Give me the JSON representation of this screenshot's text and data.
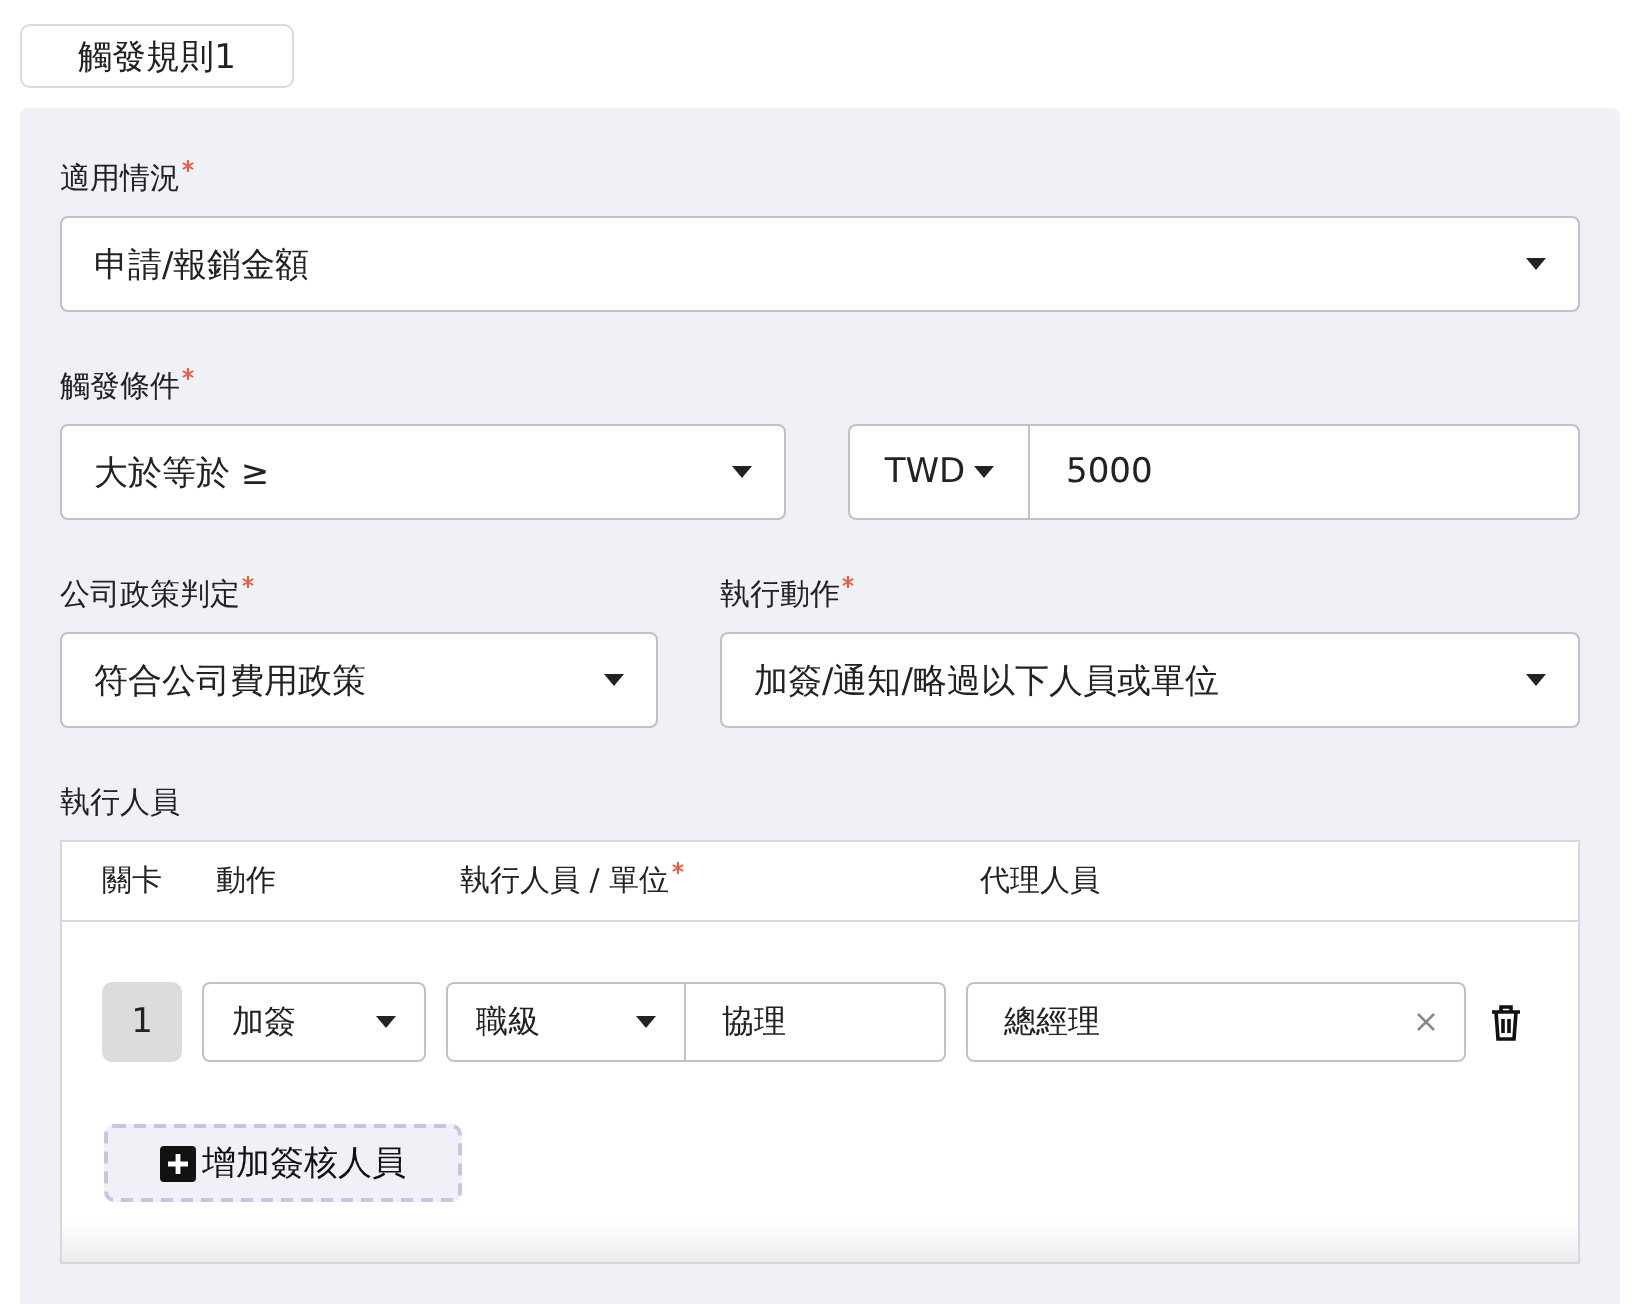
{
  "rule_tab": {
    "label": "觸發規則1"
  },
  "applicable": {
    "label": "適用情況",
    "required": true,
    "value": "申請/報銷金額"
  },
  "condition": {
    "label": "觸發條件",
    "required": true,
    "operator": "大於等於 ≥",
    "currency": "TWD",
    "amount": "5000"
  },
  "policy": {
    "label": "公司政策判定",
    "required": true,
    "value": "符合公司費用政策"
  },
  "action": {
    "label": "執行動作",
    "required": true,
    "value": "加簽/通知/略過以下人員或單位"
  },
  "executors": {
    "label": "執行人員",
    "columns": [
      {
        "label": "關卡",
        "required": false
      },
      {
        "label": "動作",
        "required": false
      },
      {
        "label": "執行人員 / 單位",
        "required": true
      },
      {
        "label": "代理人員",
        "required": false
      }
    ],
    "rows": [
      {
        "stage": "1",
        "action": "加簽",
        "type": "職級",
        "target": "協理",
        "proxy": "總經理"
      }
    ],
    "add_button": "增加簽核人員"
  }
}
